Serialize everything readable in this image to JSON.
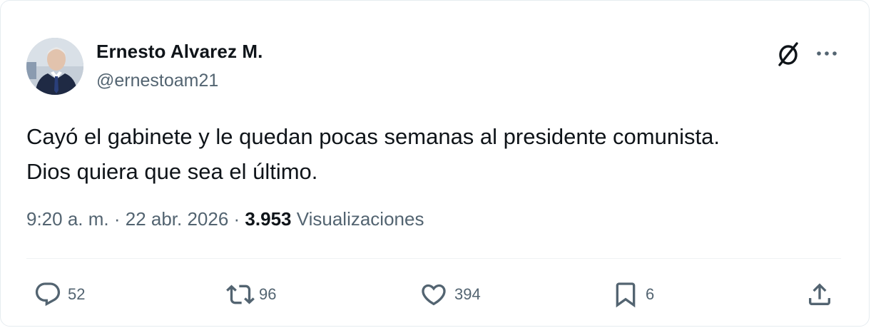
{
  "tweet": {
    "author_name": "Ernesto Alvarez M.",
    "author_handle": "@ernestoam21",
    "text_line1": "Cayó el gabinete y le quedan pocas semanas al presidente comunista.",
    "text_line2": "Dios quiera que sea el último.",
    "time": "9:20 a. m.",
    "separator": " · ",
    "date": "22 abr. 2026",
    "views_count": "3.953",
    "views_label": " Visualizaciones"
  },
  "actions": {
    "reply_count": "52",
    "retweet_count": "96",
    "like_count": "394",
    "bookmark_count": "6"
  },
  "icons": {
    "header": [
      "grok-icon",
      "more-icon"
    ],
    "actions": [
      "reply-icon",
      "retweet-icon",
      "like-icon",
      "bookmark-icon",
      "share-icon"
    ]
  },
  "colors": {
    "text_primary": "#0f1419",
    "text_secondary": "#536471",
    "divider": "#eff3f4"
  }
}
